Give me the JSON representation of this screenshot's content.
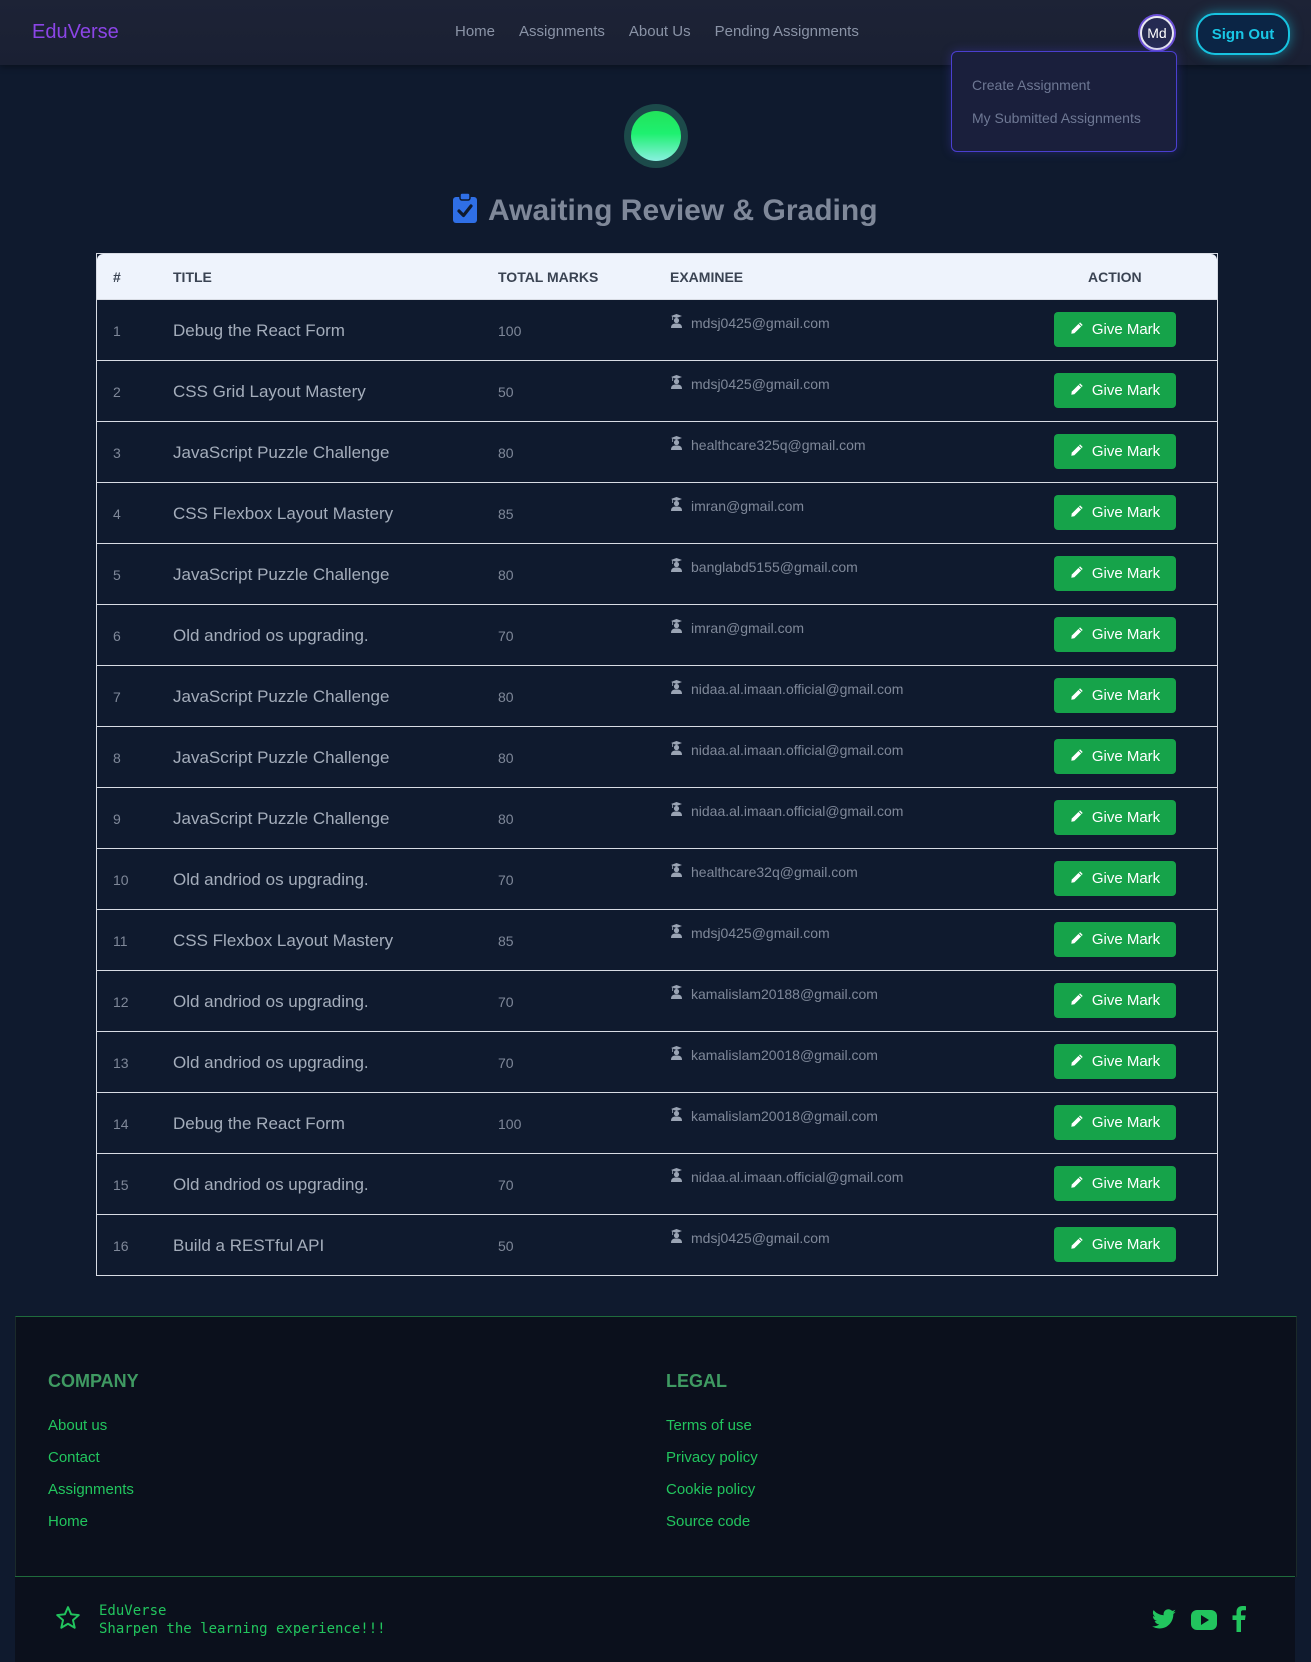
{
  "nav": {
    "brand": "EduVerse",
    "links": [
      "Home",
      "Assignments",
      "About Us",
      "Pending Assignments"
    ],
    "avatar": "Md",
    "signout": "Sign Out"
  },
  "dropdown": {
    "items": [
      "Create Assignment",
      "My Submitted Assignments"
    ]
  },
  "heading": "Awaiting Review & Grading",
  "table": {
    "headers": [
      "#",
      "TITLE",
      "TOTAL MARKS",
      "EXAMINEE",
      "ACTION"
    ],
    "button_label": "Give Mark",
    "rows": [
      {
        "num": "1",
        "title": "Debug the React Form",
        "marks": "100",
        "examinee": "mdsj0425@gmail.com"
      },
      {
        "num": "2",
        "title": "CSS Grid Layout Mastery",
        "marks": "50",
        "examinee": "mdsj0425@gmail.com"
      },
      {
        "num": "3",
        "title": "JavaScript Puzzle Challenge",
        "marks": "80",
        "examinee": "healthcare325q@gmail.com"
      },
      {
        "num": "4",
        "title": "CSS Flexbox Layout Mastery",
        "marks": "85",
        "examinee": "imran@gmail.com"
      },
      {
        "num": "5",
        "title": "JavaScript Puzzle Challenge",
        "marks": "80",
        "examinee": "banglabd5155@gmail.com"
      },
      {
        "num": "6",
        "title": "Old andriod os upgrading.",
        "marks": "70",
        "examinee": "imran@gmail.com"
      },
      {
        "num": "7",
        "title": "JavaScript Puzzle Challenge",
        "marks": "80",
        "examinee": "nidaa.al.imaan.official@gmail.com"
      },
      {
        "num": "8",
        "title": "JavaScript Puzzle Challenge",
        "marks": "80",
        "examinee": "nidaa.al.imaan.official@gmail.com"
      },
      {
        "num": "9",
        "title": "JavaScript Puzzle Challenge",
        "marks": "80",
        "examinee": "nidaa.al.imaan.official@gmail.com"
      },
      {
        "num": "10",
        "title": "Old andriod os upgrading.",
        "marks": "70",
        "examinee": "healthcare32q@gmail.com"
      },
      {
        "num": "11",
        "title": "CSS Flexbox Layout Mastery",
        "marks": "85",
        "examinee": "mdsj0425@gmail.com"
      },
      {
        "num": "12",
        "title": "Old andriod os upgrading.",
        "marks": "70",
        "examinee": "kamalislam20188@gmail.com"
      },
      {
        "num": "13",
        "title": "Old andriod os upgrading.",
        "marks": "70",
        "examinee": "kamalislam20018@gmail.com"
      },
      {
        "num": "14",
        "title": "Debug the React Form",
        "marks": "100",
        "examinee": "kamalislam20018@gmail.com"
      },
      {
        "num": "15",
        "title": "Old andriod os upgrading.",
        "marks": "70",
        "examinee": "nidaa.al.imaan.official@gmail.com"
      },
      {
        "num": "16",
        "title": "Build a RESTful API",
        "marks": "50",
        "examinee": "mdsj0425@gmail.com"
      }
    ]
  },
  "footer": {
    "company_heading": "COMPANY",
    "company_links": [
      "About us",
      "Contact",
      "Assignments",
      "Home"
    ],
    "legal_heading": "LEGAL",
    "legal_links": [
      "Terms of use",
      "Privacy policy",
      "Cookie policy",
      "Source code"
    ],
    "brand": "EduVerse",
    "tagline": "Sharpen the learning experience!!!",
    "social": [
      "twitter-icon",
      "youtube-icon",
      "facebook-icon"
    ]
  },
  "colors": {
    "brand": "#8b45e6",
    "accent_cyan": "#19c7e6",
    "button_green": "#16a34a",
    "footer_green": "#22c55e"
  }
}
